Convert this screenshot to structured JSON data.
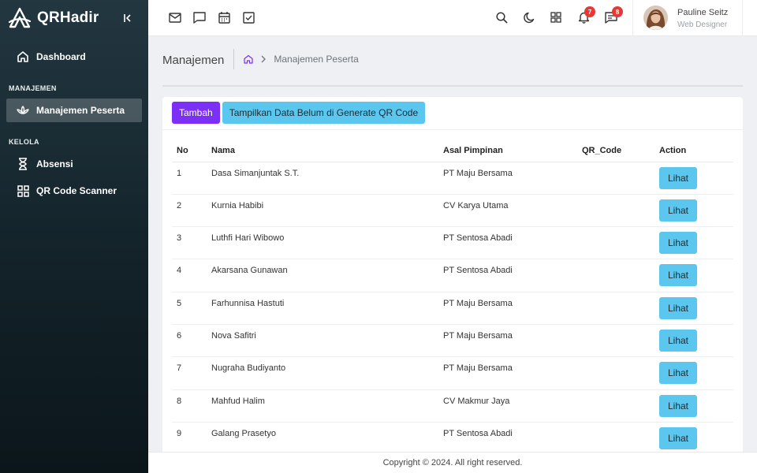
{
  "sidebar": {
    "brand": "QRHadir",
    "dashboard_label": "Dashboard",
    "section_manajemen": "MANAJEMEN",
    "manajemen_peserta_label": "Manajemen Peserta",
    "section_kelola": "KELOLA",
    "absensi_label": "Absensi",
    "qr_scanner_label": "QR Code Scanner"
  },
  "topbar": {
    "notification_count": "7",
    "message_count": "8",
    "user_name": "Pauline Seitz",
    "user_role": "Web Designer"
  },
  "breadcrumb": {
    "title": "Manajemen",
    "current": "Manajemen Peserta"
  },
  "actions": {
    "tambah": "Tambah",
    "tampilkan": "Tampilkan Data Belum di Generate QR Code"
  },
  "table": {
    "headers": [
      "No",
      "Nama",
      "Asal Pimpinan",
      "QR_Code",
      "Action"
    ],
    "rows": [
      {
        "no": "1",
        "nama": "Dasa Simanjuntak S.T.",
        "asal": "PT Maju Bersama",
        "qr": "",
        "action": "Lihat"
      },
      {
        "no": "2",
        "nama": "Kurnia Habibi",
        "asal": "CV Karya Utama",
        "qr": "",
        "action": "Lihat"
      },
      {
        "no": "3",
        "nama": "Luthfi Hari Wibowo",
        "asal": "PT Sentosa Abadi",
        "qr": "",
        "action": "Lihat"
      },
      {
        "no": "4",
        "nama": "Akarsana Gunawan",
        "asal": "PT Sentosa Abadi",
        "qr": "",
        "action": "Lihat"
      },
      {
        "no": "5",
        "nama": "Farhunnisa Hastuti",
        "asal": "PT Maju Bersama",
        "qr": "",
        "action": "Lihat"
      },
      {
        "no": "6",
        "nama": "Nova Safitri",
        "asal": "PT Maju Bersama",
        "qr": "",
        "action": "Lihat"
      },
      {
        "no": "7",
        "nama": "Nugraha Budiyanto",
        "asal": "PT Maju Bersama",
        "qr": "",
        "action": "Lihat"
      },
      {
        "no": "8",
        "nama": "Mahfud Halim",
        "asal": "CV Makmur Jaya",
        "qr": "",
        "action": "Lihat"
      },
      {
        "no": "9",
        "nama": "Galang Prasetyo",
        "asal": "PT Sentosa Abadi",
        "qr": "",
        "action": "Lihat"
      }
    ]
  },
  "footer": {
    "copyright": "Copyright © 2024. All right reserved."
  },
  "colors": {
    "primary": "#7b2ff7",
    "info": "#5bc7ee",
    "badge": "#e53935"
  }
}
